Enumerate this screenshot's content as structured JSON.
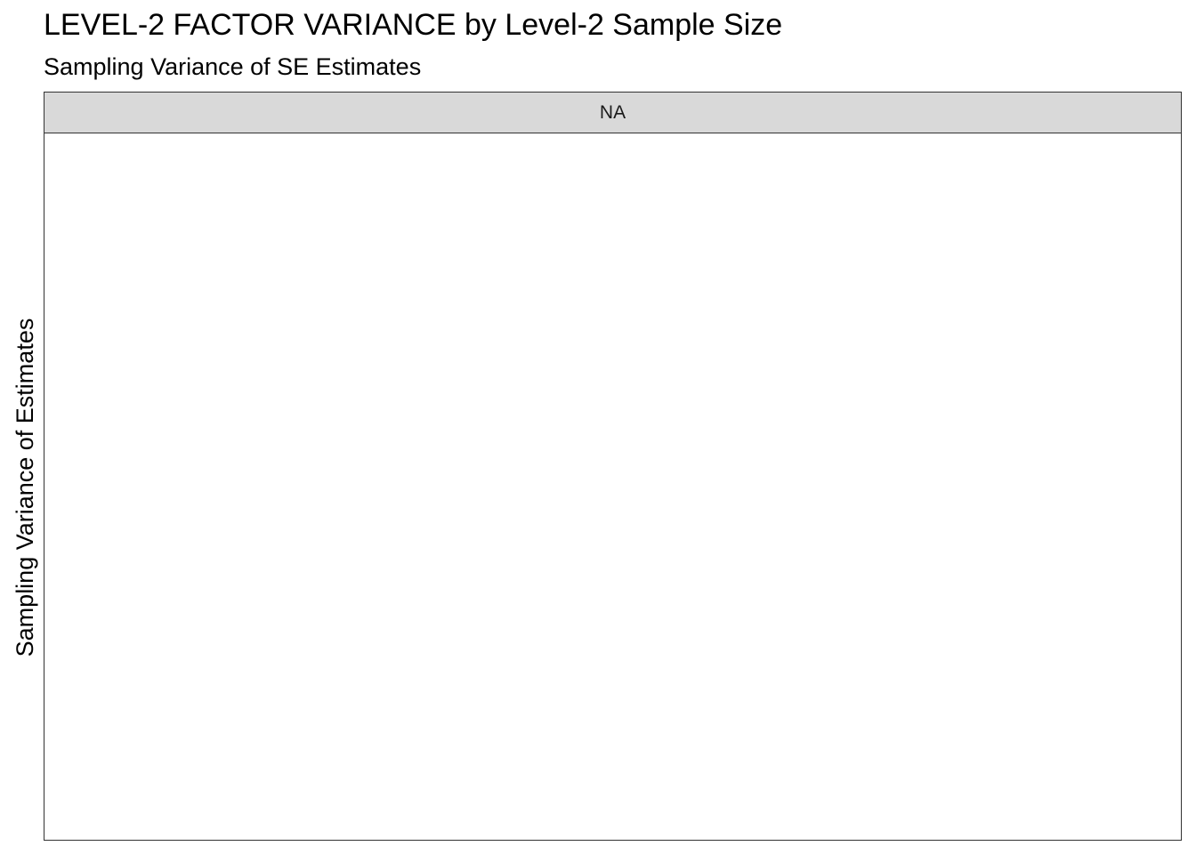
{
  "chart_data": {
    "type": "scatter",
    "title": "LEVEL-2 FACTOR VARIANCE by Level-2 Sample Size",
    "subtitle": "Sampling Variance of SE Estimates",
    "ylabel": "Sampling Variance of Estimates",
    "facets": [
      {
        "label": "NA",
        "series": []
      }
    ],
    "grid": false,
    "legend": "none"
  }
}
